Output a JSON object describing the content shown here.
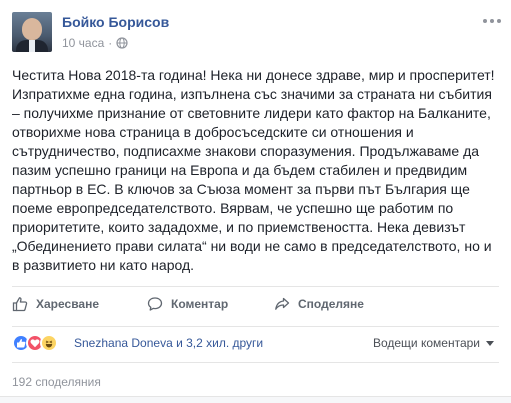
{
  "post": {
    "author": "Бойко Борисов",
    "time": "10 часа",
    "privacy_icon": "globe-icon",
    "text": "Честита Нова 2018-та година! Нека ни донесе здраве, мир и просперитет! Изпратихме една година, изпълнена със значими за страната ни събития – получихме признание от световните лидери като фактор на Балканите, отворихме нова страница в добросъседските си отношения и сътрудничество, подписахме знакови споразумения. Продължаваме да пазим успешно граници на Европа и да бъдем стабилен и предвидим партньор в ЕС. В ключов за Съюза момент за първи път България ще поеме европредседателството. Вярвам, че успешно ще работим по приоритетите, които зададохме, и по приемствеността. Нека девизът „Обединението прави силата“ ни води не само в председателството, но и в развитието ни като народ."
  },
  "actions": {
    "like_label": "Харесване",
    "comment_label": "Коментар",
    "share_label": "Споделяне"
  },
  "reactions": {
    "icons": [
      "like",
      "love",
      "haha"
    ],
    "summary": "Snezhana Doneva и 3,2 хил. други",
    "sort_label": "Водещи коментари"
  },
  "shares": {
    "count_label": "192 споделяния"
  },
  "colors": {
    "link": "#365899",
    "muted": "#90949c",
    "like": "#4080ff",
    "love": "#f25268",
    "haha": "#fcd463"
  }
}
